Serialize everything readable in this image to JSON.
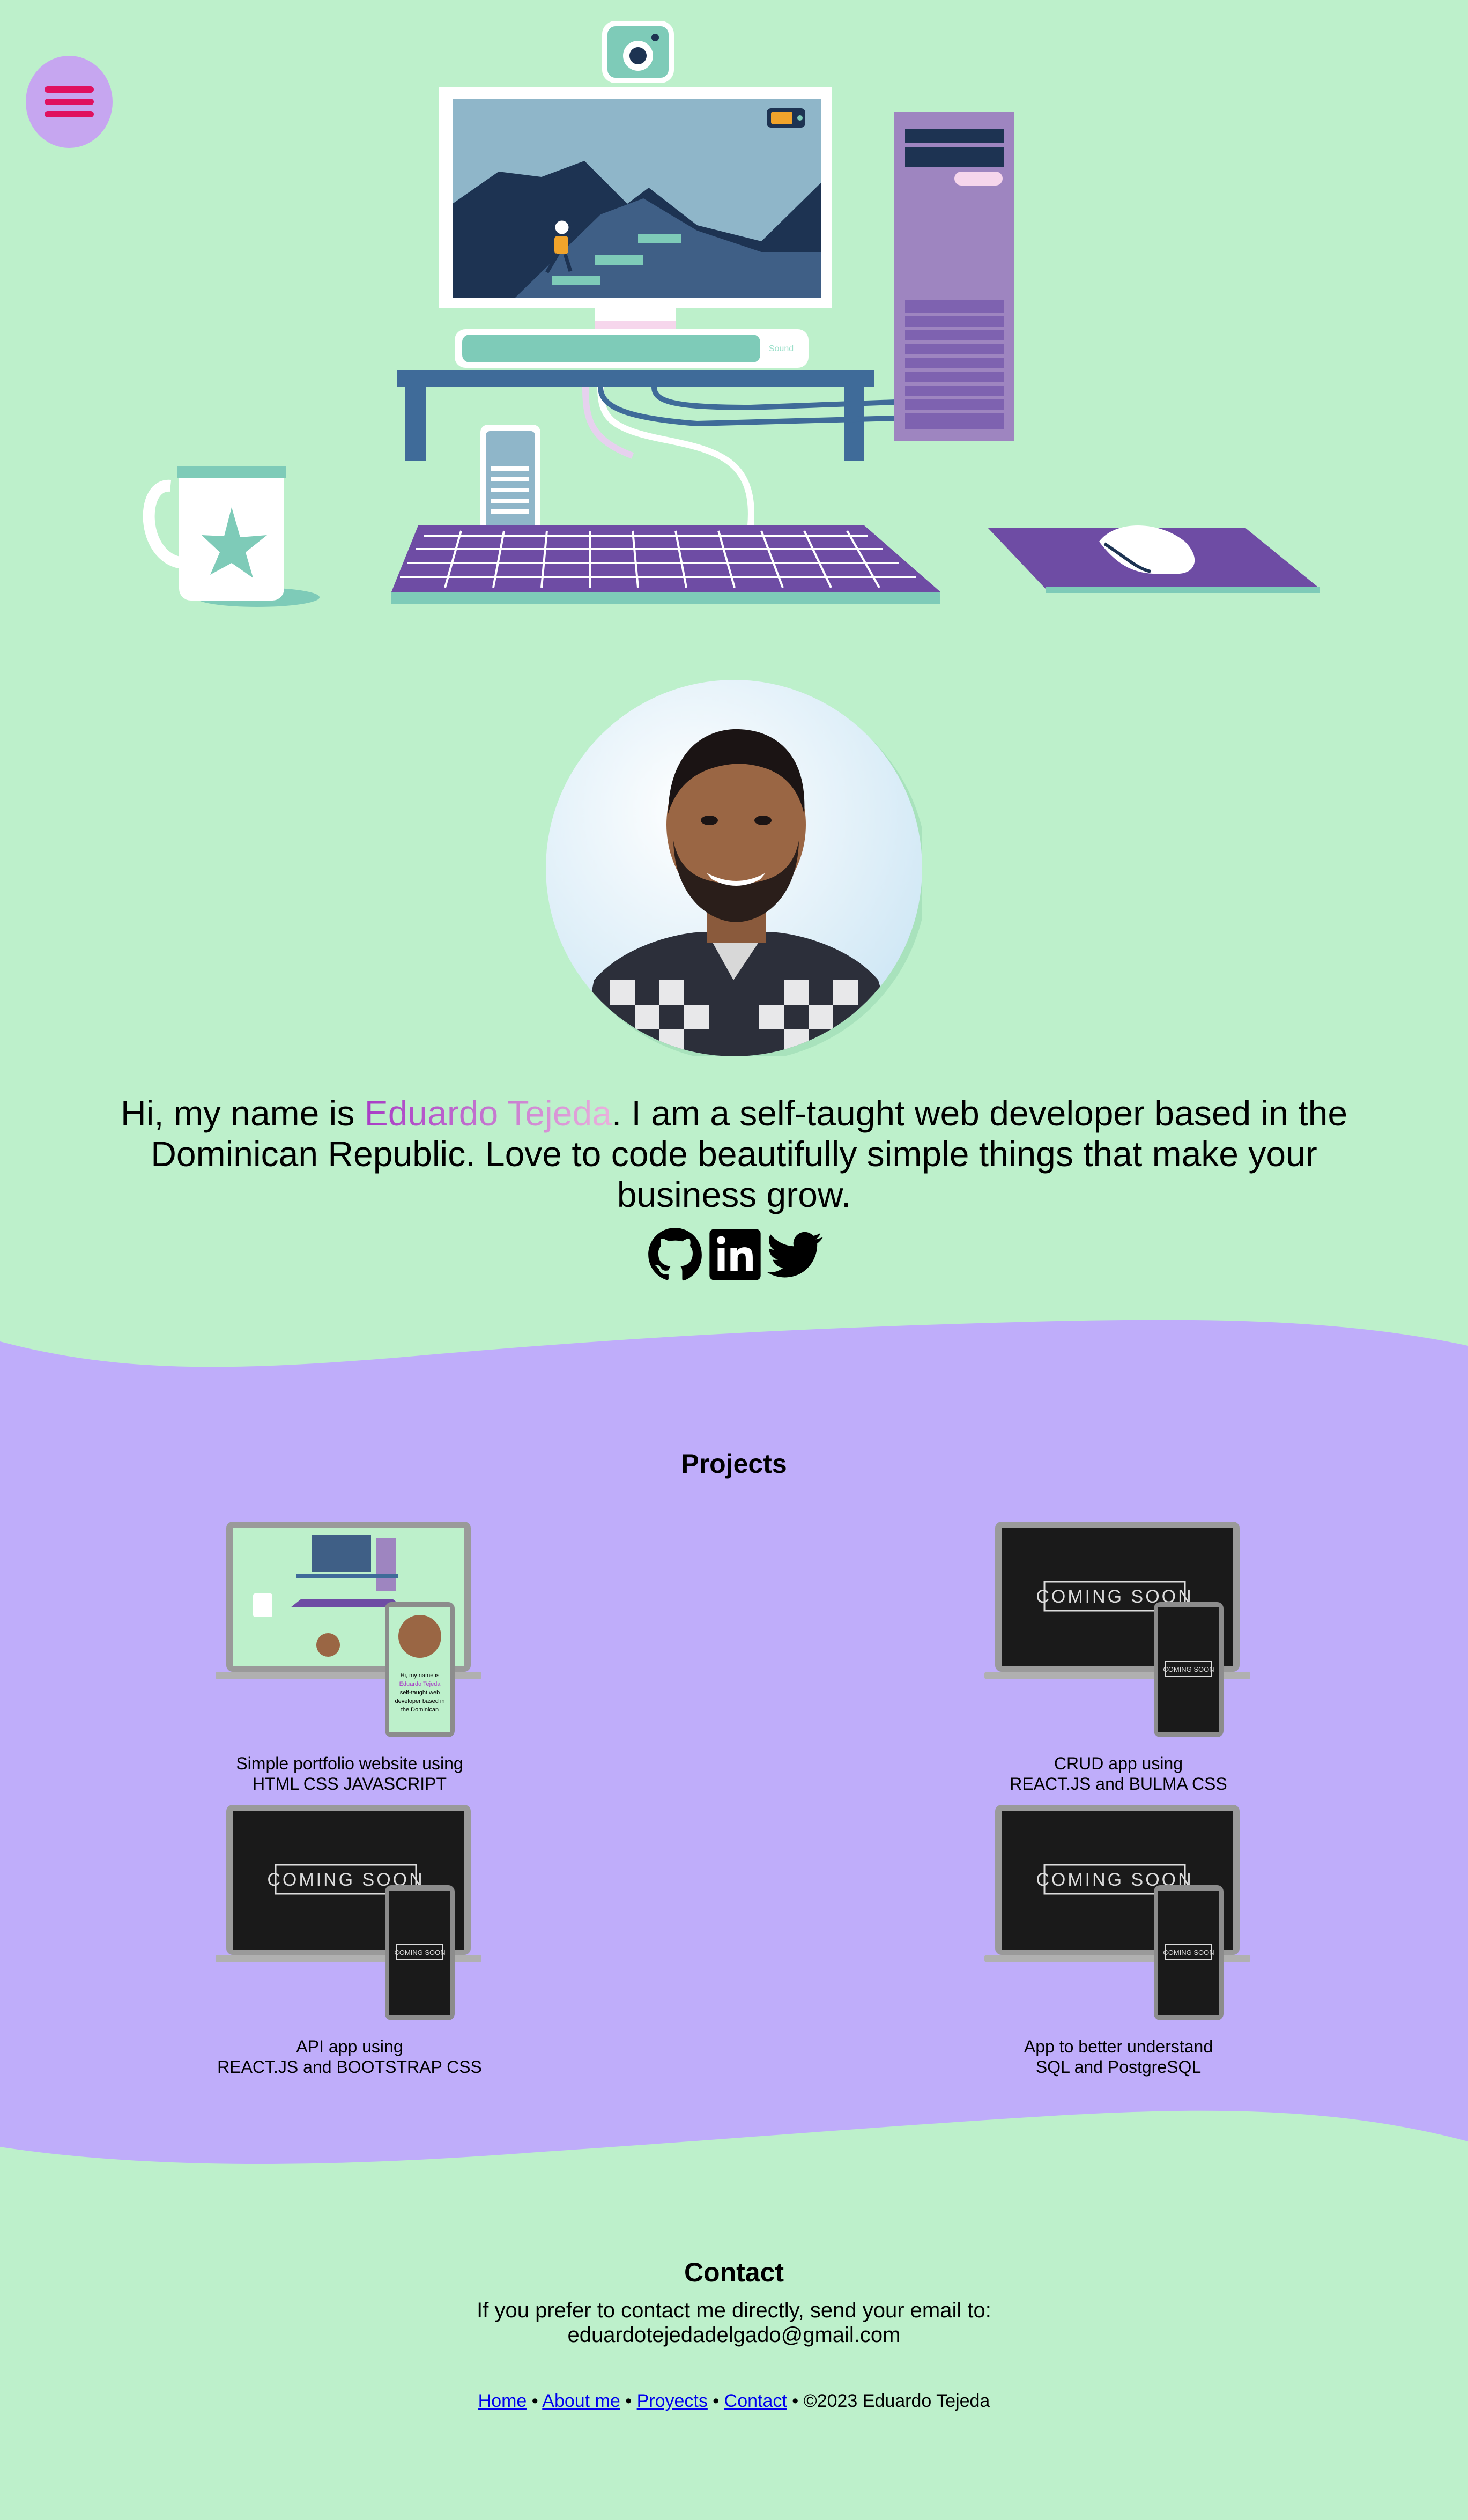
{
  "colors": {
    "background": "#bdf0cb",
    "projects_band": "#bfadfa",
    "menu_button": "#c6a6f0",
    "menu_bars": "#e0115f",
    "name_gradient_start": "#a83cc6",
    "name_gradient_end": "#eab1dd",
    "link": "#0000ee"
  },
  "menu": {
    "icon": "hamburger-icon"
  },
  "hero": {
    "monitor_sound_label": "Sound"
  },
  "intro": {
    "before_name": "Hi, my name is ",
    "name": "Eduardo Tejeda",
    "after_name": ". I am a self-taught web developer based in the Dominican Republic. Love to code beautifully simple things that make your business grow."
  },
  "social": [
    {
      "icon": "github-icon"
    },
    {
      "icon": "linkedin-icon"
    },
    {
      "icon": "twitter-icon"
    }
  ],
  "projects": {
    "title": "Projects",
    "items": [
      {
        "line1": "Simple portfolio website using",
        "line2": "HTML CSS JAVASCRIPT",
        "screen": "portfolio"
      },
      {
        "line1": "CRUD app using",
        "line2": "REACT.JS and BULMA CSS",
        "screen": "COMING SOON"
      },
      {
        "line1": "API app using",
        "line2": "REACT.JS and BOOTSTRAP CSS",
        "screen": "COMING SOON"
      },
      {
        "line1": "App to better understand",
        "line2": "SQL and PostgreSQL",
        "screen": "COMING SOON"
      }
    ],
    "mini_intro": "Hi, my name is Eduardo Tejeda. I am a self-taught web developer based in the Dominican Republic. Love to code beautifully"
  },
  "contact": {
    "title": "Contact",
    "line1": "If you prefer to contact me directly, send your email to:",
    "email": "eduardotejedadelgado@gmail.com"
  },
  "footer": {
    "links": [
      "Home",
      "About me",
      "Proyects",
      "Contact"
    ],
    "separator": " • ",
    "copyright": "©2023 Eduardo Tejeda"
  }
}
